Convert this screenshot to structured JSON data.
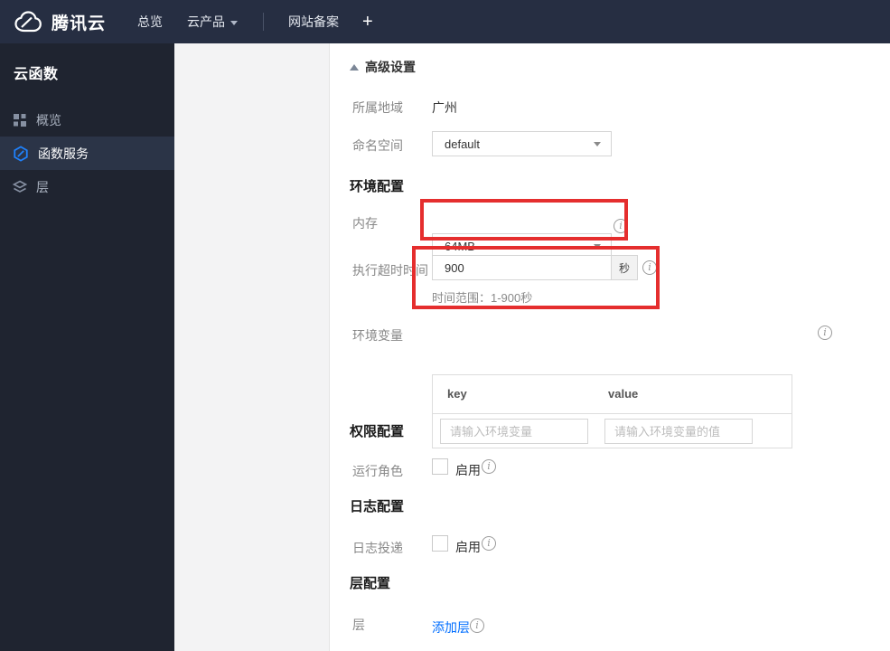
{
  "colors": {
    "annotation_red": "#e52e2e",
    "link_blue": "#006eff",
    "selected_icon_blue": "#1f82fd",
    "topbar_bg": "#262e42",
    "sidebar_bg": "#1f2430"
  },
  "topbar": {
    "brand": "腾讯云",
    "nav": [
      "总览",
      "云产品",
      "网站备案",
      "+"
    ]
  },
  "sidebar": {
    "title": "云函数",
    "items": [
      {
        "label": "概览"
      },
      {
        "label": "函数服务"
      },
      {
        "label": "层"
      }
    ]
  },
  "main": {
    "advanced_settings_label": "高级设置",
    "region": {
      "label": "所属地域",
      "value": "广州"
    },
    "namespace": {
      "label": "命名空间",
      "value": "default"
    },
    "section_environment": "环境配置",
    "memory": {
      "label": "内存",
      "value": "64MB"
    },
    "timeout": {
      "label": "执行超时时间",
      "value": "900",
      "unit": "秒",
      "hint": "时间范围：1-900秒"
    },
    "env_vars": {
      "label": "环境变量",
      "key_header": "key",
      "value_header": "value",
      "key_placeholder": "请输入环境变量",
      "value_placeholder": "请输入环境变量的值"
    },
    "section_permission": "权限配置",
    "run_role": {
      "label": "运行角色",
      "checkbox_label": "启用"
    },
    "section_log": "日志配置",
    "log_delivery": {
      "label": "日志投递",
      "checkbox_label": "启用"
    },
    "section_layer": "层配置",
    "layer": {
      "label": "层",
      "add_link": "添加层"
    }
  }
}
